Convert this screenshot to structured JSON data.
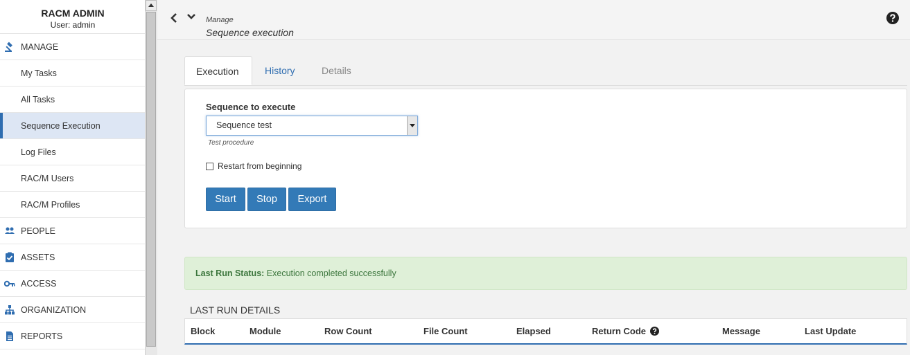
{
  "sidebar": {
    "brand_title": "RACM ADMIN",
    "user_label": "User: admin",
    "items": [
      {
        "label": "MANAGE",
        "icon": "gavel-icon"
      },
      {
        "label": "My Tasks"
      },
      {
        "label": "All Tasks"
      },
      {
        "label": "Sequence Execution",
        "active": true
      },
      {
        "label": "Log Files"
      },
      {
        "label": "RAC/M Users"
      },
      {
        "label": "RAC/M Profiles"
      },
      {
        "label": "PEOPLE",
        "icon": "people-icon"
      },
      {
        "label": "ASSETS",
        "icon": "clipboard-check-icon"
      },
      {
        "label": "ACCESS",
        "icon": "key-icon"
      },
      {
        "label": "ORGANIZATION",
        "icon": "org-chart-icon"
      },
      {
        "label": "REPORTS",
        "icon": "document-icon"
      }
    ]
  },
  "header": {
    "breadcrumb": "Manage",
    "title": "Sequence execution"
  },
  "tabs": [
    "Execution",
    "History",
    "Details"
  ],
  "form": {
    "sequence_label": "Sequence to execute",
    "sequence_value": "Sequence test",
    "sequence_hint": "Test procedure",
    "restart_label": "Restart from beginning",
    "buttons": {
      "start": "Start",
      "stop": "Stop",
      "export": "Export"
    }
  },
  "status": {
    "label": "Last Run Status:",
    "text": "Execution completed successfully"
  },
  "last_run": {
    "title": "LAST RUN DETAILS",
    "columns": [
      "Block",
      "Module",
      "Row Count",
      "File Count",
      "Elapsed",
      "Return Code",
      "Message",
      "Last Update"
    ]
  },
  "colors": {
    "accent": "#337ab7",
    "success_bg": "#dff0d8",
    "success_text": "#3c763d"
  }
}
